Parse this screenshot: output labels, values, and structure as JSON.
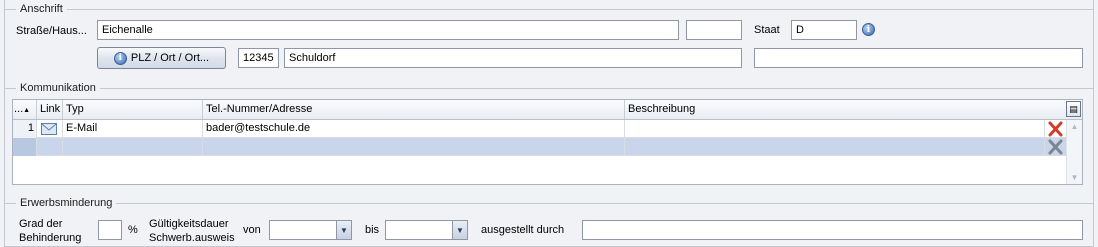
{
  "anschrift": {
    "section_title": "Anschrift",
    "strasse_label": "Straße/Haus...",
    "strasse_value": "Eichenalle",
    "hausnr_value": "",
    "staat_label": "Staat",
    "staat_value": "D",
    "plz_button_label": "PLZ / Ort / Ort...",
    "plz_value": "12345",
    "ort_value": "Schuldorf",
    "extra_value": ""
  },
  "kommunikation": {
    "section_title": "Kommunikation",
    "columns": [
      "...",
      "Link",
      "Typ",
      "Tel.-Nummer/Adresse",
      "Beschreibung"
    ],
    "rows": [
      {
        "index": "1",
        "link_icon": "mail-icon",
        "typ": "E-Mail",
        "adresse": "bader@testschule.de",
        "beschreibung": ""
      },
      {
        "index": "",
        "link_icon": "",
        "typ": "",
        "adresse": "",
        "beschreibung": ""
      }
    ]
  },
  "erwerbsminderung": {
    "section_title": "Erwerbsminderung",
    "grad_label_1": "Grad der",
    "grad_label_2": "Behinderung",
    "grad_value": "",
    "percent_label": "%",
    "gueltig_label_1": "Gültigkeitsdauer",
    "gueltig_label_2": "Schwerb.ausweis",
    "von_label": "von",
    "von_value": "",
    "bis_label": "bis",
    "bis_value": "",
    "ausgestellt_label": "ausgestellt durch",
    "ausgestellt_value": ""
  },
  "colors": {
    "background": "#f0f2f5",
    "selected_row": "#c8d5ea",
    "delete_red": "#d63a2b"
  }
}
